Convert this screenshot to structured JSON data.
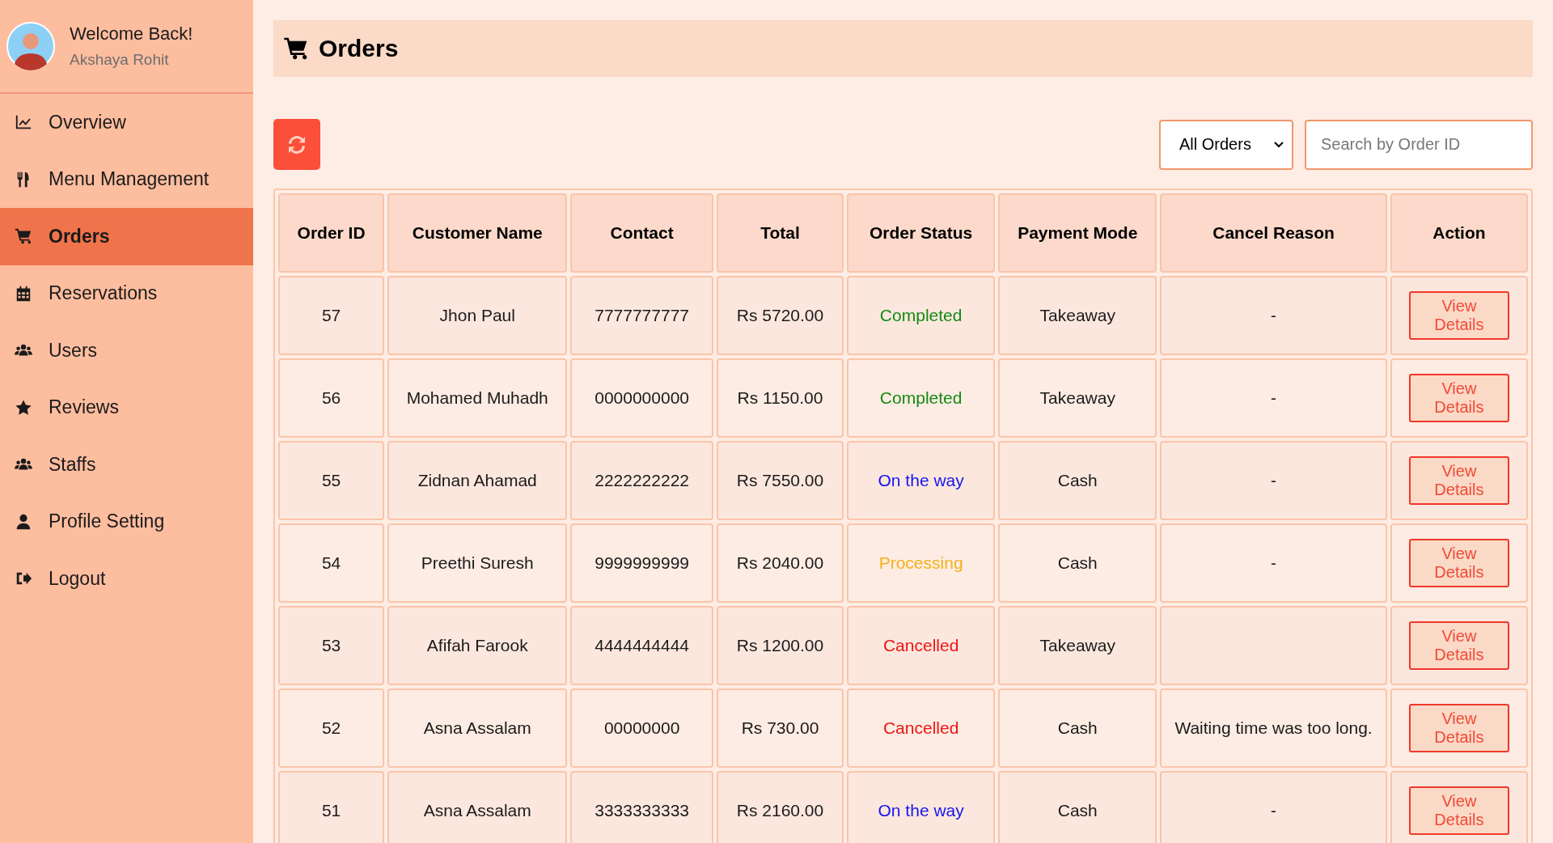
{
  "sidebar": {
    "greeting": "Welcome Back!",
    "user_name": "Akshaya Rohit",
    "items": [
      {
        "label": "Overview",
        "selected": false
      },
      {
        "label": "Menu Management",
        "selected": false
      },
      {
        "label": "Orders",
        "selected": true
      },
      {
        "label": "Reservations",
        "selected": false
      },
      {
        "label": "Users",
        "selected": false
      },
      {
        "label": "Reviews",
        "selected": false
      },
      {
        "label": "Staffs",
        "selected": false
      },
      {
        "label": "Profile Setting",
        "selected": false
      },
      {
        "label": "Logout",
        "selected": false
      }
    ]
  },
  "page": {
    "title": "Orders"
  },
  "toolbar": {
    "filter": {
      "value": "All Orders"
    },
    "search": {
      "placeholder": "Search by Order ID"
    }
  },
  "table": {
    "columns": [
      "Order ID",
      "Customer Name",
      "Contact",
      "Total",
      "Order Status",
      "Payment Mode",
      "Cancel Reason",
      "Action"
    ],
    "rows": [
      {
        "order_id": "57",
        "customer": "Jhon Paul",
        "contact": "7777777777",
        "total": "Rs 5720.00",
        "status": "Completed",
        "color": "#138a13",
        "payment": "Takeaway",
        "cancel_reason": "-",
        "action": "View Details"
      },
      {
        "order_id": "56",
        "customer": "Mohamed Muhadh",
        "contact": "0000000000",
        "total": "Rs 1150.00",
        "status": "Completed",
        "color": "#138a13",
        "payment": "Takeaway",
        "cancel_reason": "-",
        "action": "View Details"
      },
      {
        "order_id": "55",
        "customer": "Zidnan Ahamad",
        "contact": "2222222222",
        "total": "Rs 7550.00",
        "status": "On the way",
        "color": "#1515ee",
        "payment": "Cash",
        "cancel_reason": "-",
        "action": "View Details"
      },
      {
        "order_id": "54",
        "customer": "Preethi Suresh",
        "contact": "9999999999",
        "total": "Rs 2040.00",
        "status": "Processing",
        "color": "#f2b21c",
        "payment": "Cash",
        "cancel_reason": "-",
        "action": "View Details"
      },
      {
        "order_id": "53",
        "customer": "Afifah Farook",
        "contact": "4444444444",
        "total": "Rs 1200.00",
        "status": "Cancelled",
        "color": "#ee1414",
        "payment": "Takeaway",
        "action": "View Details"
      },
      {
        "order_id": "52",
        "customer": "Asna Assalam",
        "contact": "00000000",
        "total": "Rs 730.00",
        "status": "Cancelled",
        "color": "#ee1414",
        "payment": "Cash",
        "cancel_reason": "Waiting time was too long.",
        "action": "View Details"
      },
      {
        "order_id": "51",
        "customer": "Asna Assalam",
        "contact": "3333333333",
        "total": "Rs 2160.00",
        "status": "On the way",
        "color": "#1515ee",
        "payment": "Cash",
        "cancel_reason": "-",
        "action": "View Details"
      }
    ]
  }
}
